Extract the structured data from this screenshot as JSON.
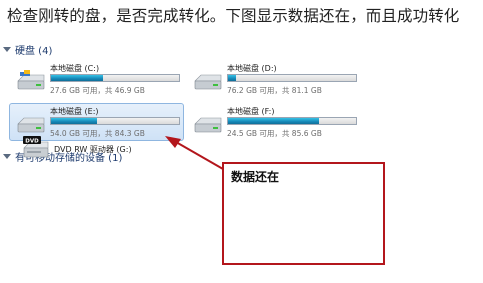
{
  "headline": "检查刚转的盘，是否完成转化。下图显示数据还在，而且成功转化",
  "hard_disks": {
    "header": "硬盘 (4)",
    "drives": [
      {
        "name": "本地磁盘 (C:)",
        "info": "27.6 GB 可用，共 46.9 GB",
        "used_fraction": 0.41
      },
      {
        "name": "本地磁盘 (D:)",
        "info": "76.2 GB 可用，共 81.1 GB",
        "used_fraction": 0.06
      },
      {
        "name": "本地磁盘 (E:)",
        "info": "54.0 GB 可用，共 84.3 GB",
        "used_fraction": 0.36
      },
      {
        "name": "本地磁盘 (F:)",
        "info": "24.5 GB 可用，共 85.6 GB",
        "used_fraction": 0.71
      }
    ]
  },
  "removable": {
    "header": "有可移动存储的设备 (1)",
    "devices": [
      {
        "name": "DVD RW 驱动器 (G:)",
        "icon_text": "DVD"
      }
    ]
  },
  "annotation": {
    "text": "数据还在",
    "color": "#b3161c"
  }
}
